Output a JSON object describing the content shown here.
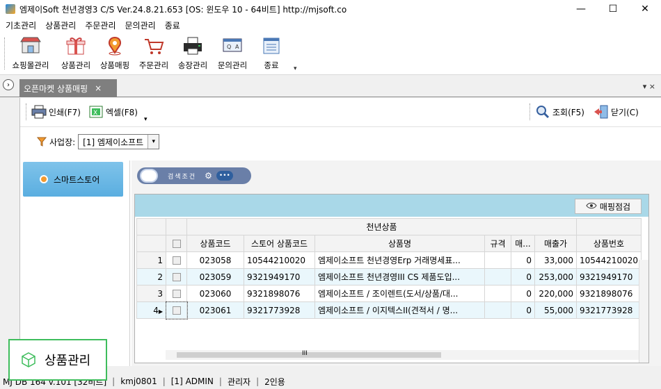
{
  "window": {
    "title": "엠제이Soft 천년경영3 C/S  Ver.24.8.21.653  [OS: 윈도우 10 - 64비트]  http://mjsoft.co",
    "minimize": "—",
    "maximize": "☐",
    "close": "✕"
  },
  "menu": [
    "기초관리",
    "상품관리",
    "주문관리",
    "문의관리",
    "종료"
  ],
  "toolbar": {
    "items": [
      {
        "label": "쇼핑몰관리",
        "icon": "shop-icon"
      },
      {
        "label": "상품관리",
        "icon": "gift-icon"
      },
      {
        "label": "상품매핑",
        "icon": "map-pin-icon"
      },
      {
        "label": "주문관리",
        "icon": "cart-icon"
      },
      {
        "label": "송장관리",
        "icon": "printer-icon"
      },
      {
        "label": "문의관리",
        "icon": "qa-icon"
      },
      {
        "label": "종료",
        "icon": "exit-icon"
      }
    ],
    "more": "▾"
  },
  "tabs": {
    "active_label": "오픈마켓 상품매핑",
    "close": "×",
    "controls": "▾  ×",
    "collapse": "›"
  },
  "subtoolbar": {
    "print": "인쇄(F7)",
    "excel": "엑셀(F8)",
    "search": "조회(F5)",
    "close": "닫기(C)"
  },
  "filter": {
    "label": "사업장:",
    "value": "[1] 엠제이소프트",
    "dropdown": "▾"
  },
  "side": {
    "item": "스마트스토어"
  },
  "search_pill": {
    "text": "검색조건",
    "gear": "⚙",
    "dots": "•••"
  },
  "grid": {
    "verify_button": "매핑점검",
    "group_header": "천년상품",
    "columns": [
      "상품코드",
      "스토어 상품코드",
      "상품명",
      "규격",
      "매...",
      "매출가",
      "상품번호"
    ],
    "rows": [
      {
        "num": "1",
        "code": "023058",
        "store_code": "10544210020",
        "name": "엠제이소프트 천년경영Erp 거래명세표...",
        "spec": "",
        "qty": "0",
        "price": "33,000",
        "prod_no": "10544210020"
      },
      {
        "num": "2",
        "code": "023059",
        "store_code": "9321949170",
        "name": "엠제이소프트 천년경영III CS 제품도입...",
        "spec": "",
        "qty": "0",
        "price": "253,000",
        "prod_no": "9321949170"
      },
      {
        "num": "3",
        "code": "023060",
        "store_code": "9321898076",
        "name": "엠제이소프트 / 조이렌트(도서/상품/대...",
        "spec": "",
        "qty": "0",
        "price": "220,000",
        "prod_no": "9321898076"
      },
      {
        "num": "4",
        "code": "023061",
        "store_code": "9321773928",
        "name": "엠제이소프트 / 이지텍스II(견적서 / 명...",
        "spec": "",
        "qty": "0",
        "price": "55,000",
        "prod_no": "9321773928"
      }
    ],
    "scroll_mark": "III"
  },
  "status": {
    "db": "MJ DB 164 v.101 [32비트]",
    "user": "kmj0801",
    "company": "[1] ADMIN",
    "role": "관리자",
    "users": "2인용"
  },
  "badge": {
    "label": "상품관리"
  },
  "colors": {
    "tab_bg": "#7f7f7f",
    "grid_header_bar": "#a9d8e8",
    "side_item": "#5aaee0",
    "badge_border": "#3ebd5c"
  }
}
